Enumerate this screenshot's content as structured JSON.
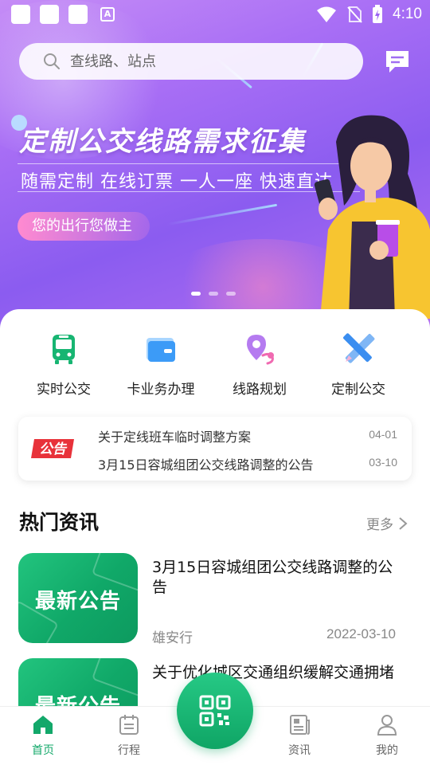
{
  "status_bar": {
    "time": "4:10"
  },
  "search": {
    "placeholder": "查线路、站点"
  },
  "banner": {
    "title": "定制公交线路需求征集",
    "subtitle": "随需定制  在线订票  一人一座  快速直达",
    "pill": "您的出行您做主",
    "page_count": 3,
    "active_page": 1
  },
  "quick_actions": [
    {
      "label": "实时公交",
      "icon": "bus-icon"
    },
    {
      "label": "卡业务办理",
      "icon": "card-wallet-icon"
    },
    {
      "label": "线路规划",
      "icon": "route-pin-icon"
    },
    {
      "label": "定制公交",
      "icon": "ruler-pencil-icon"
    }
  ],
  "notice": {
    "badge": "公告",
    "items": [
      {
        "text": "关于定线班车临时调整方案",
        "date": "04-01"
      },
      {
        "text": "3月15日容城组团公交线路调整的公告",
        "date": "03-10"
      }
    ]
  },
  "hot_news": {
    "title": "热门资讯",
    "more": "更多",
    "items": [
      {
        "thumb_label": "最新公告",
        "title": "3月15日容城组团公交线路调整的公告",
        "source": "雄安行",
        "date": "2022-03-10"
      },
      {
        "thumb_label": "最新公告",
        "title": "关于优化城区交通组织缓解交通拥堵",
        "source": "",
        "date": ""
      }
    ]
  },
  "tabbar": {
    "items": [
      {
        "label": "首页",
        "icon": "home-icon",
        "active": true
      },
      {
        "label": "行程",
        "icon": "calendar-icon",
        "active": false
      },
      {
        "label": "资讯",
        "icon": "newspaper-icon",
        "active": false
      },
      {
        "label": "我的",
        "icon": "user-icon",
        "active": false
      }
    ],
    "scan_icon": "qr-scan-icon"
  },
  "colors": {
    "primary_green": "#13a86a",
    "banner_purple": "#a86ef5",
    "notice_red": "#e8323a"
  }
}
